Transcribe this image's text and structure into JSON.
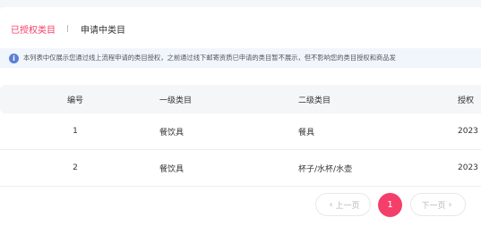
{
  "tabs": [
    {
      "label": "已授权类目",
      "active": true
    },
    {
      "label": "申请中类目",
      "active": false
    }
  ],
  "notice": {
    "icon": "info-icon",
    "icon_glyph": "i",
    "text": "本列表中仅展示您通过线上流程申请的类目授权，之前通过线下邮寄资质已申请的类目暂不展示，但不影响您的类目授权和商品发"
  },
  "table": {
    "columns": [
      "编号",
      "一级类目",
      "二级类目",
      "授权"
    ],
    "rows": [
      {
        "num": "1",
        "level1": "餐饮具",
        "level2": "餐具",
        "auth": "2023"
      },
      {
        "num": "2",
        "level1": "餐饮具",
        "level2": "杯子/水杯/水壶",
        "auth": "2023"
      }
    ]
  },
  "pagination": {
    "prev_label": "上一页",
    "next_label": "下一页",
    "prev_chevron": "‹",
    "next_chevron": "›",
    "current_page": "1"
  },
  "colors": {
    "accent": "#f43f6a",
    "info": "#5b7fd6",
    "notice_bg": "#f1f5fc",
    "header_bg": "#f5f6f8"
  }
}
